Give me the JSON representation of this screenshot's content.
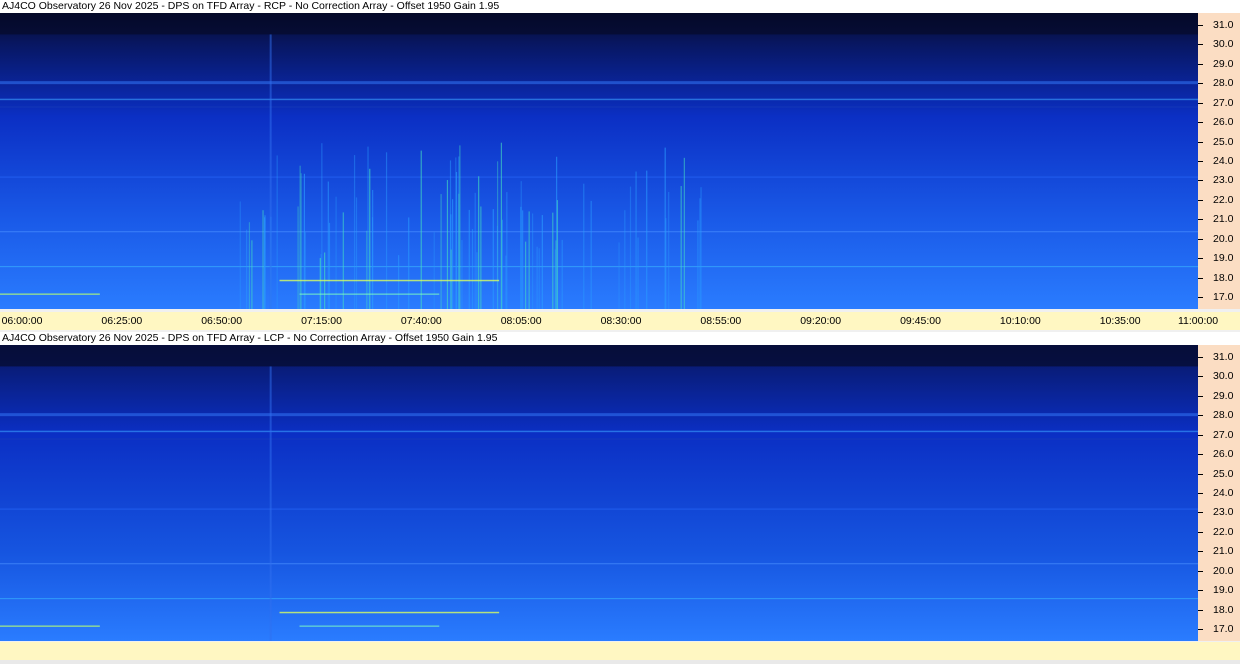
{
  "colors": {
    "dark": "#050a2a",
    "mid": "#0b2fc4",
    "bright": "#1060ff",
    "hot": "#7fffc0",
    "axis_bg": "#fbddc3",
    "time_bg": "#fff7c2"
  },
  "chart_data": [
    {
      "type": "heatmap",
      "title": "AJ4CO Observatory 26 Nov 2025 - DPS on TFD Array  - RCP  -  No Correction Array  -  Offset 1950 Gain 1.95",
      "ylabel": "",
      "xlabel": "",
      "y_ticks": [
        "31.0",
        "30.0",
        "29.0",
        "28.0",
        "27.0",
        "26.0",
        "25.0",
        "24.0",
        "23.0",
        "22.0",
        "21.0",
        "20.0",
        "19.0",
        "18.0",
        "17.0"
      ],
      "ylim": [
        16.4,
        31.6
      ],
      "x_ticks": [
        "06:00:00",
        "06:25:00",
        "06:50:00",
        "07:15:00",
        "07:40:00",
        "08:05:00",
        "08:30:00",
        "08:55:00",
        "09:20:00",
        "09:45:00",
        "10:10:00",
        "10:35:00",
        "11:00:00"
      ],
      "xlim": [
        "06:00:00",
        "11:00:00"
      ]
    },
    {
      "type": "heatmap",
      "title": "AJ4CO Observatory 26 Nov 2025 - DPS on TFD Array  - LCP  -  No Correction Array  -  Offset 1950 Gain 1.95",
      "ylabel": "",
      "xlabel": "",
      "y_ticks": [
        "31.0",
        "30.0",
        "29.0",
        "28.0",
        "27.0",
        "26.0",
        "25.0",
        "24.0",
        "23.0",
        "22.0",
        "21.0",
        "20.0",
        "19.0",
        "18.0",
        "17.0"
      ],
      "ylim": [
        16.4,
        31.6
      ],
      "x_ticks": [],
      "xlim": [
        "06:00:00",
        "11:00:00"
      ]
    }
  ]
}
